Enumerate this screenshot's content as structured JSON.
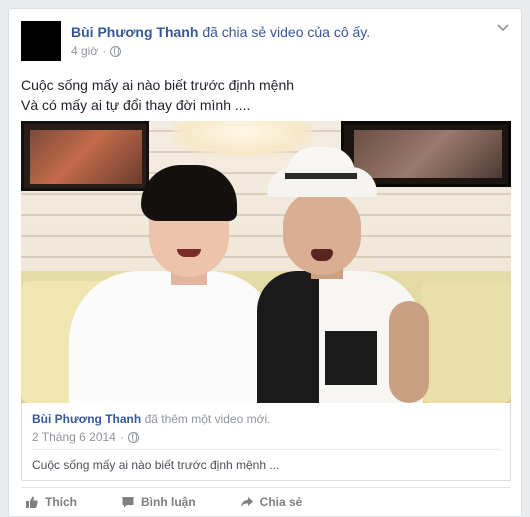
{
  "post": {
    "author": "Bùi Phương Thanh",
    "action_text": "đã chia sẻ video của cô ấy.",
    "time": "4 giờ",
    "dot": "·",
    "text_line1": "Cuộc sống mấy ai nào biết trước định mệnh",
    "text_line2": "Và có mấy ai tự đổi thay đời mình ...."
  },
  "shared": {
    "author": "Bùi Phương Thanh",
    "action_text": "đã thêm một video mới.",
    "date": "2 Tháng 6 2014",
    "dot": "·",
    "text": "Cuộc sống mấy ai nào biết trước định mệnh ..."
  },
  "actions": {
    "like": "Thích",
    "comment": "Bình luận",
    "share": "Chia sẻ"
  },
  "icons": {
    "privacy": "globe-icon",
    "menu": "chevron-down-icon",
    "like": "thumbs-up-icon",
    "comment": "comment-icon",
    "share": "share-arrow-icon"
  },
  "colors": {
    "link": "#365899",
    "muted": "#90949c",
    "action": "#7f7f7f"
  }
}
